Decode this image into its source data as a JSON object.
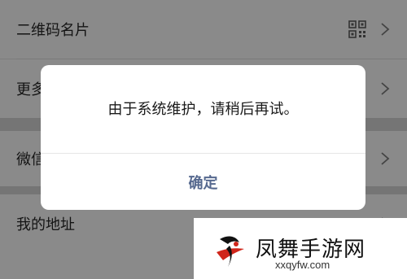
{
  "list": {
    "items": [
      {
        "label": "二维码名片"
      },
      {
        "label": "更多"
      },
      {
        "label": "微信"
      },
      {
        "label": "我的地址"
      }
    ]
  },
  "dialog": {
    "message": "由于系统维护，请稍后再试。",
    "confirm_label": "确定",
    "confirm_color": "#56698f"
  },
  "watermark": {
    "title": "凤舞手游网",
    "url": "xxqyfw.com",
    "accent": "#d0261b"
  }
}
